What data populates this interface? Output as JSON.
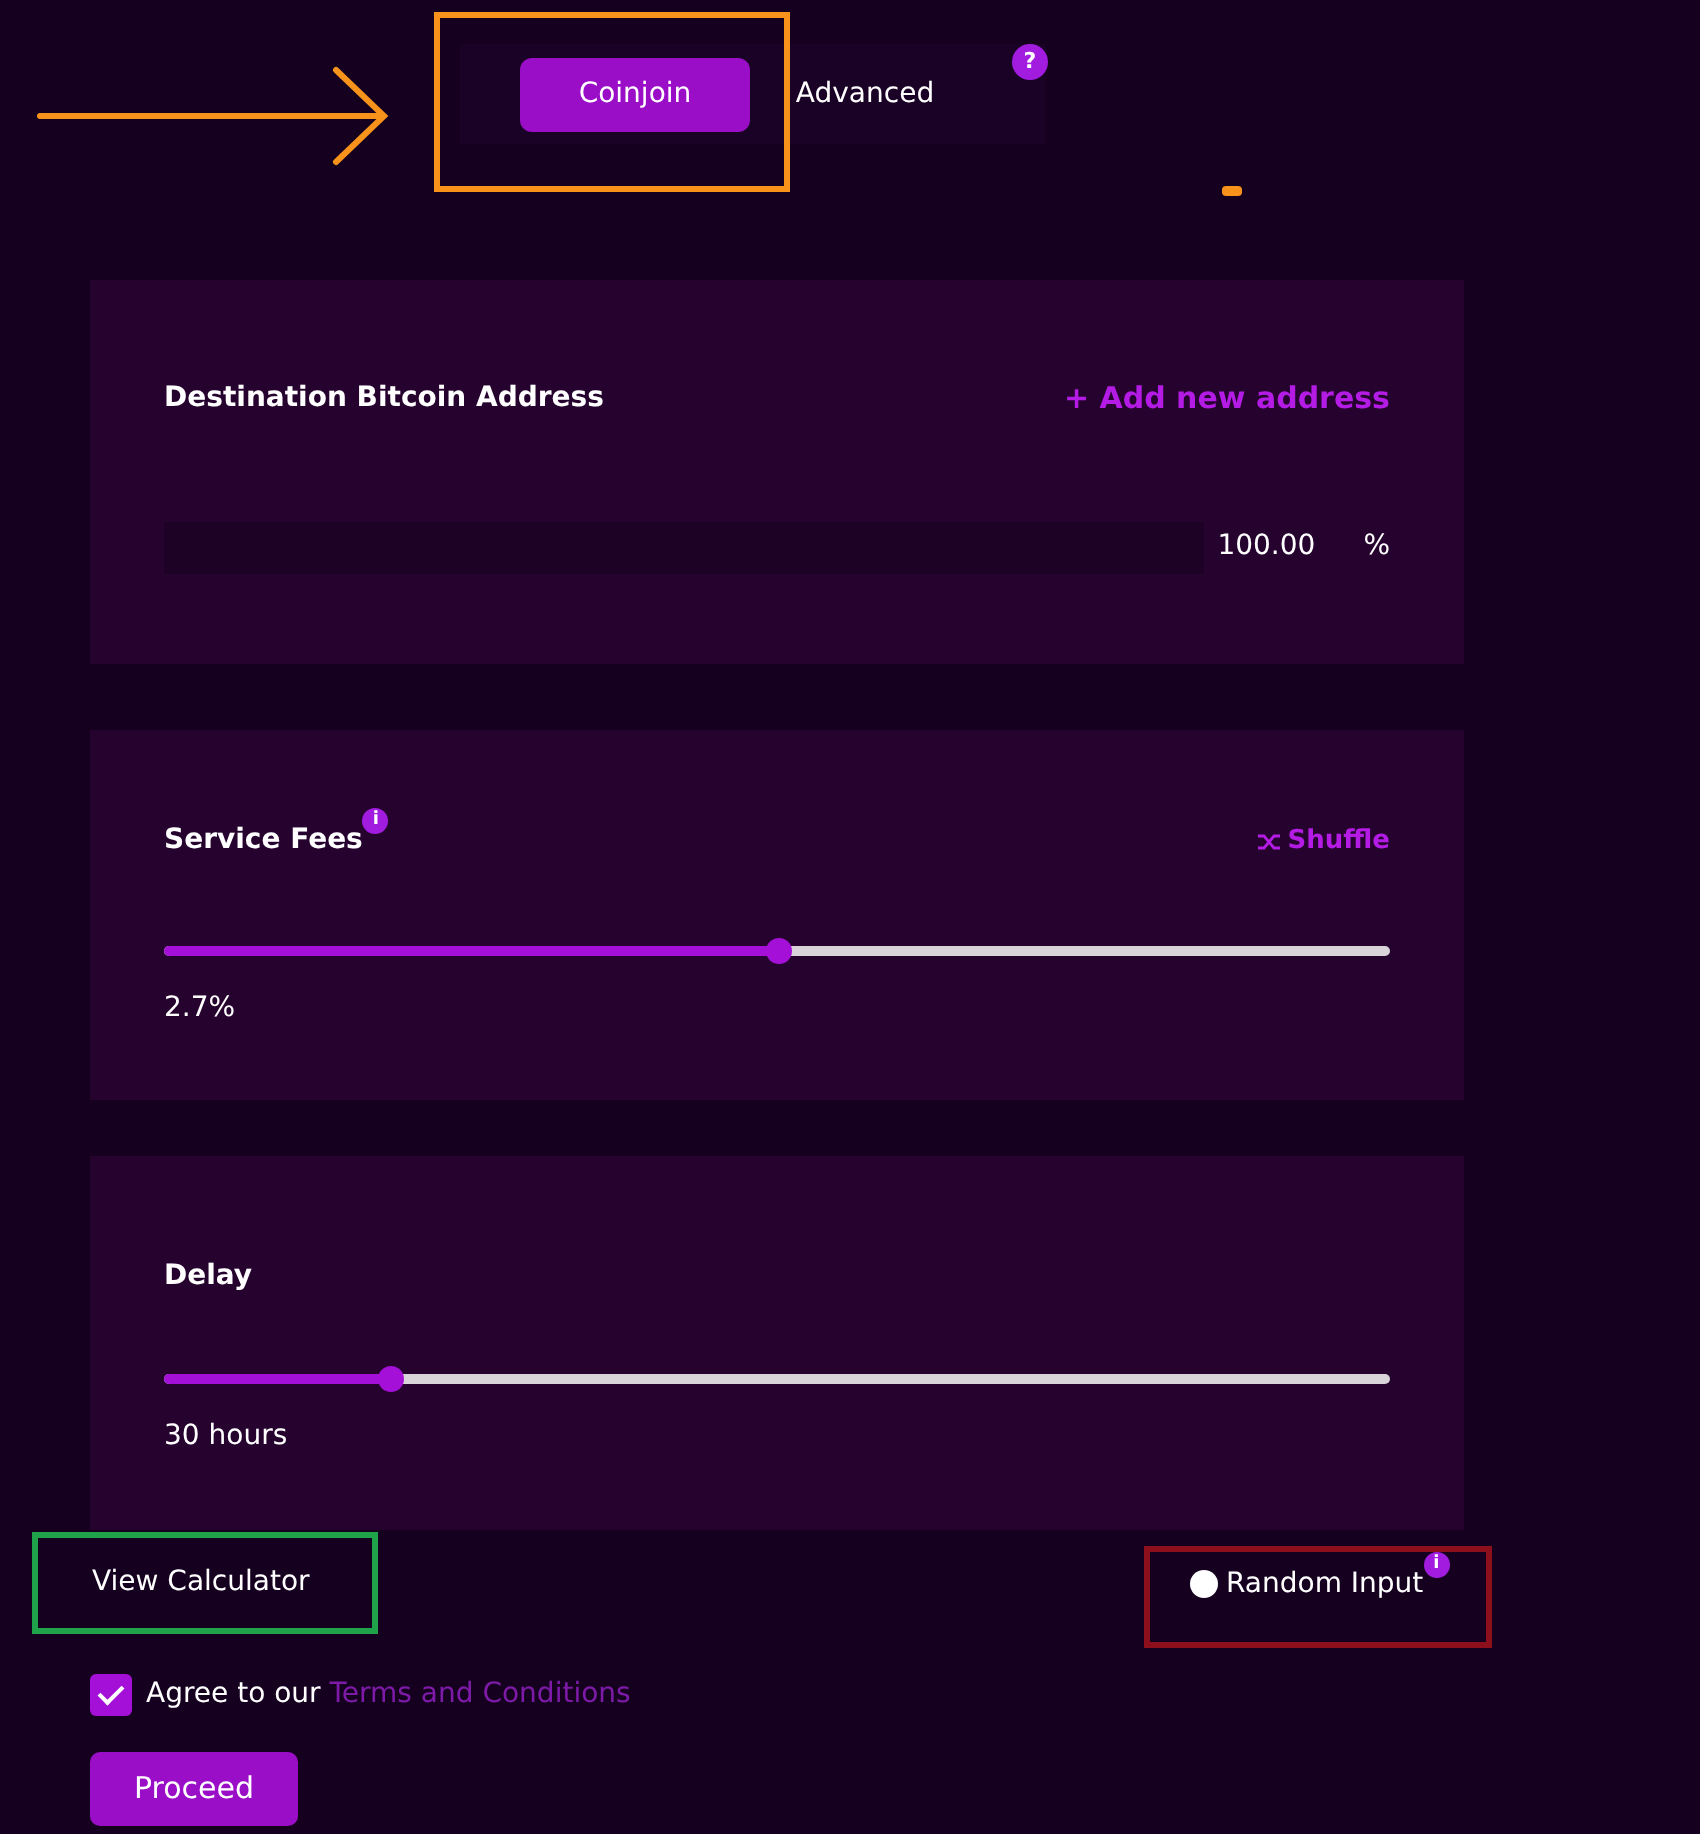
{
  "tabs": [
    {
      "label": "Coinjoin",
      "selected": true
    },
    {
      "label": "Advanced",
      "selected": false
    }
  ],
  "tabs_help": "?",
  "destination": {
    "title": "Destination Bitcoin Address",
    "add_link": "+ Add new address",
    "amount": "100.00",
    "unit": "%"
  },
  "service_fees": {
    "title": "Service Fees",
    "info": "i",
    "shuffle": "Shuffle",
    "level": 0.5,
    "reading": "2.7%"
  },
  "delay": {
    "title": "Delay",
    "level": 0.185,
    "reading": "30 hours"
  },
  "view_calculator": "View Calculator",
  "random_input": {
    "label": "Random Input",
    "info": "i",
    "checked": false
  },
  "agree": {
    "checked": true,
    "text": "Agree to our ",
    "link": "Terms and Conditions"
  },
  "proceed": "Proceed",
  "annotations": [
    {
      "kind": "arrow",
      "color": "#f7931a"
    },
    {
      "kind": "box",
      "color": "#f7931a"
    },
    {
      "kind": "dash",
      "color": "#f7931a"
    },
    {
      "kind": "box",
      "color": "#1fa34a"
    },
    {
      "kind": "box",
      "color": "#8e0f1c"
    }
  ]
}
